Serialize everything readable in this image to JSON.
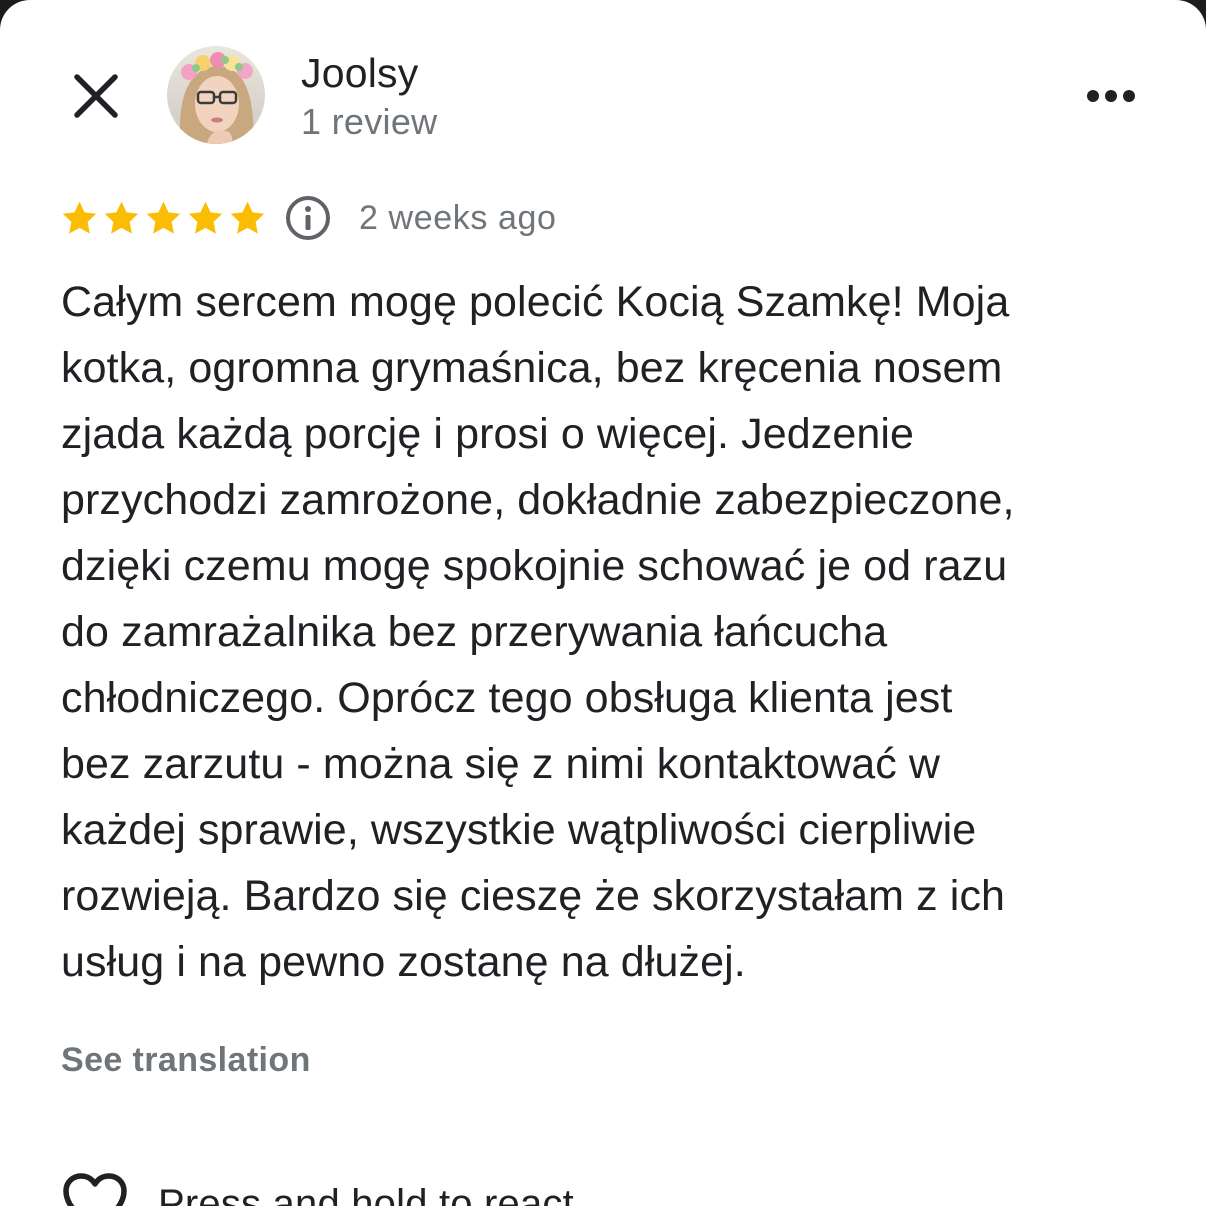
{
  "header": {
    "close_icon": "close-icon",
    "user_name": "Joolsy",
    "user_meta": "1 review",
    "more_icon": "more-options-icon"
  },
  "review": {
    "rating": 5,
    "rating_max": 5,
    "star_color": "#fbbc04",
    "info_icon": "info-icon",
    "date": "2 weeks ago",
    "lines": [
      "Całym sercem mogę polecić Kocią Szamkę! Moja",
      "kotka, ogromna grymaśnica, bez kręcenia nosem",
      "zjada każdą porcję i prosi o więcej. Jedzenie",
      "przychodzi zamrożone, dokładnie zabezpieczone,",
      "dzięki czemu mogę spokojnie schować je od razu",
      "do zamrażalnika bez przerywania łańcucha",
      "chłodniczego. Oprócz tego obsługa klienta jest",
      "bez zarzutu - można się z nimi kontaktować w",
      "każdej sprawie, wszystkie wątpliwości cierpliwie",
      "rozwieją. Bardzo się cieszę że skorzystałam z ich",
      "usług i na pewno zostanę na dłużej."
    ],
    "see_translation": "See translation"
  },
  "react": {
    "heart_icon": "heart-icon",
    "label": "Press and hold to react"
  }
}
